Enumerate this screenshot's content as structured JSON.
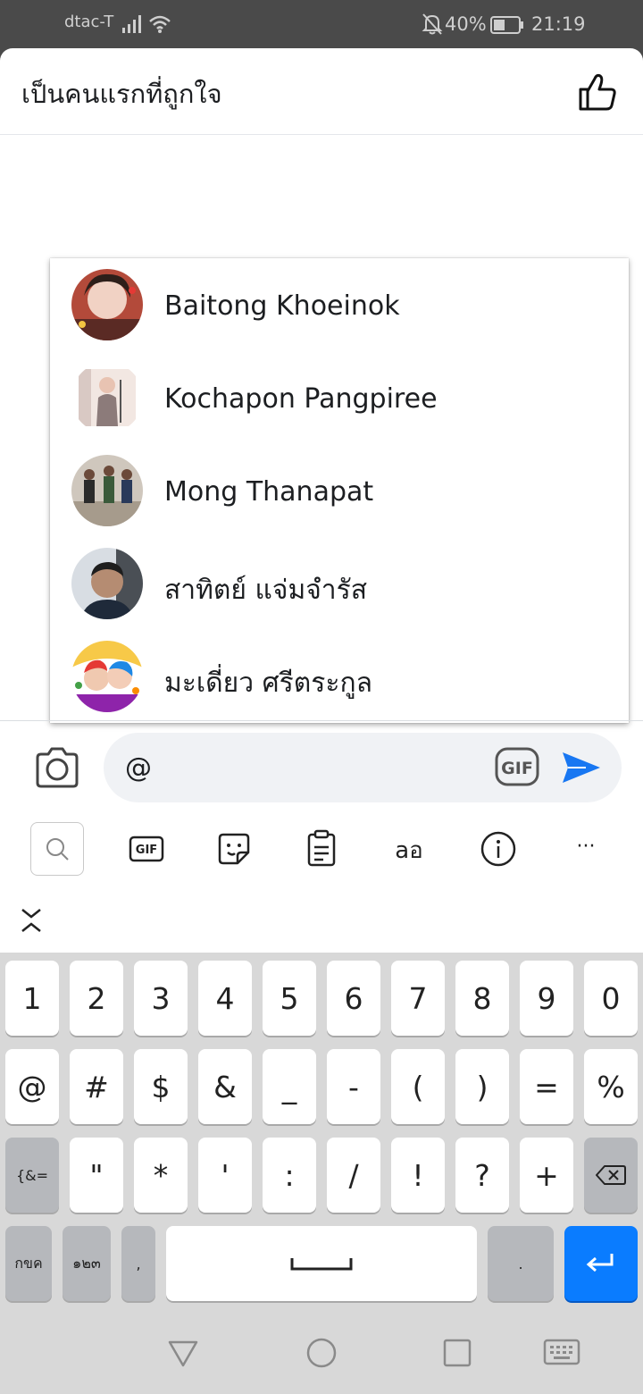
{
  "status_bar": {
    "carrier": "dtac-T",
    "battery": "40%",
    "time": "21:19",
    "icons": [
      "signal-icon",
      "wifi-icon",
      "bell-off-icon",
      "battery-icon"
    ]
  },
  "header": {
    "title": "เป็นคนแรกที่ถูกใจ",
    "like_icon": "thumbs-up-icon"
  },
  "mentions": [
    {
      "name": "Baitong Khoeinok"
    },
    {
      "name": "Kochapon Pangpiree"
    },
    {
      "name": "Mong Thanapat"
    },
    {
      "name": "สาทิตย์ แจ่มจำรัส"
    },
    {
      "name": "มะเดี่ยว ศรีตระกูล"
    }
  ],
  "composer": {
    "text": "@",
    "camera_icon": "camera-icon",
    "gif_label": "GIF",
    "send_icon": "send-icon"
  },
  "keyboard_toolbar": {
    "gif_label": "GIF",
    "translate_label": "aอ",
    "more_label": "···",
    "icons": [
      "search-icon",
      "gif-icon",
      "sticker-icon",
      "clipboard-icon",
      "translate-icon",
      "info-icon",
      "more-icon",
      "collapse-icon"
    ]
  },
  "keyboard": {
    "row1": [
      "1",
      "2",
      "3",
      "4",
      "5",
      "6",
      "7",
      "8",
      "9",
      "0"
    ],
    "row2": [
      "@",
      "#",
      "$",
      "&",
      "_",
      "-",
      "(",
      ")",
      "=",
      "%"
    ],
    "row3": [
      "{&=",
      "\"",
      "*",
      "'",
      ":",
      "/",
      "!",
      "?",
      "+"
    ],
    "row4": [
      "กขค",
      "๑๒๓",
      ",",
      "."
    ],
    "enter_color": "#0a7cff"
  },
  "colors": {
    "accent": "#1877f2",
    "composer_bg": "#f0f2f5",
    "status_bar_bg": "#4a4a4a"
  }
}
